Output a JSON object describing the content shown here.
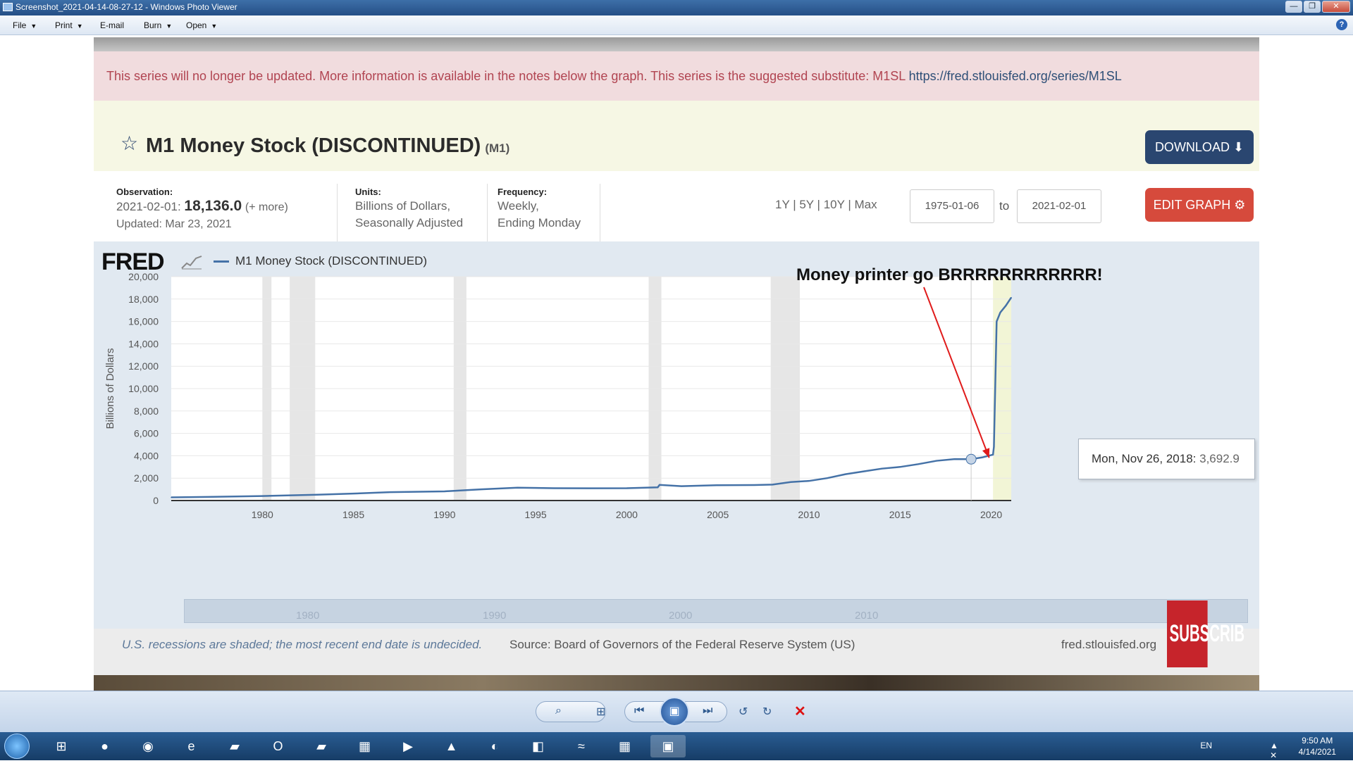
{
  "window": {
    "title": "Screenshot_2021-04-14-08-27-12 - Windows Photo Viewer",
    "buttons": {
      "minimize": "—",
      "maximize": "❐",
      "close": "✕"
    }
  },
  "menu": {
    "items": [
      "File",
      "Print",
      "E-mail",
      "Burn",
      "Open"
    ],
    "help": "?"
  },
  "fred": {
    "warning_text": "This series will no longer be updated. More information is available in the notes below the graph. This series is the suggested substitute: M1SL ",
    "warning_link": "https://fred.stlouisfed.org/series/M1SL",
    "title": "M1 Money Stock (DISCONTINUED)",
    "series_id": "(M1)",
    "download_label": "DOWNLOAD",
    "observation": {
      "label": "Observation:",
      "date": "2021-02-01:",
      "value": "18,136.0",
      "more": "(+ more)",
      "updated": "Updated: Mar 23, 2021"
    },
    "units": {
      "label": "Units:",
      "line1": "Billions of Dollars,",
      "line2": "Seasonally Adjusted"
    },
    "frequency": {
      "label": "Frequency:",
      "line1": "Weekly,",
      "line2": "Ending Monday"
    },
    "ranges": "1Y | 5Y | 10Y | Max",
    "date_from": "1975-01-06",
    "to_label": "to",
    "date_to": "2021-02-01",
    "edit_label": "EDIT GRAPH",
    "logo": "FRED",
    "legend": "M1 Money Stock (DISCONTINUED)",
    "annotation": "Money printer go BRRRRRRRRRRRR!",
    "tooltip_date": "Mon, Nov 26, 2018:",
    "tooltip_value": "3,692.9",
    "navigator_labels": [
      "1980",
      "1990",
      "2000",
      "2010"
    ],
    "footer_note": "U.S. recessions are shaded; the most recent end date is undecided.",
    "footer_source": "Source: Board of Governors of the Federal Reserve System (US)",
    "footer_site": "fred.stlouisfed.org",
    "overlay_sticker": "SUBSCRIB"
  },
  "chart_data": {
    "type": "line",
    "ylabel": "Billions of Dollars",
    "ylim": [
      0,
      20000
    ],
    "xlim": [
      1975,
      2021.1
    ],
    "yticks": [
      0,
      2000,
      4000,
      6000,
      8000,
      10000,
      12000,
      14000,
      16000,
      18000,
      20000
    ],
    "ytick_labels": [
      "0",
      "2,000",
      "4,000",
      "6,000",
      "8,000",
      "10,000",
      "12,000",
      "14,000",
      "16,000",
      "18,000",
      "20,000"
    ],
    "xticks": [
      1980,
      1985,
      1990,
      1995,
      2000,
      2005,
      2010,
      2015,
      2020
    ],
    "xtick_labels": [
      "1980",
      "1985",
      "1990",
      "1995",
      "2000",
      "2005",
      "2010",
      "2015",
      "2020"
    ],
    "recessions": [
      [
        1980.0,
        1980.5
      ],
      [
        1981.5,
        1982.9
      ],
      [
        1990.5,
        1991.2
      ],
      [
        2001.2,
        2001.9
      ],
      [
        2007.9,
        2009.5
      ],
      [
        2020.1,
        2021.1
      ]
    ],
    "series": [
      {
        "name": "M1 Money Stock (DISCONTINUED)",
        "color": "#4572a7",
        "x": [
          1975,
          1977,
          1980,
          1983,
          1985,
          1987,
          1990,
          1992,
          1994,
          1996,
          1998,
          2000,
          2001.7,
          2001.8,
          2003,
          2005,
          2007,
          2008,
          2009,
          2010,
          2011,
          2012,
          2013,
          2014,
          2015,
          2016,
          2017,
          2018,
          2018.9,
          2019.5,
          2020.1,
          2020.15,
          2020.3,
          2020.5,
          2020.8,
          2021.1
        ],
        "y": [
          280,
          320,
          400,
          520,
          620,
          750,
          820,
          1000,
          1150,
          1100,
          1090,
          1100,
          1180,
          1400,
          1280,
          1370,
          1380,
          1420,
          1650,
          1750,
          2000,
          2350,
          2600,
          2850,
          3000,
          3250,
          3550,
          3700,
          3693,
          3850,
          4100,
          4800,
          16000,
          16800,
          17400,
          18136
        ]
      }
    ]
  },
  "toolbar": {
    "zoom": "⌕",
    "fit": "⊞",
    "prev": "⏮",
    "slideshow": "▣",
    "next": "⏭",
    "rotate_ccw": "↺",
    "rotate_cw": "↻",
    "delete": "✕"
  },
  "taskbar": {
    "apps": [
      "⊞",
      "●",
      "◉",
      "e",
      "▰",
      "O",
      "▰",
      "▦",
      "▶",
      "▲",
      "◐",
      "◧",
      "≈",
      "▦",
      "▣"
    ],
    "lang": "EN",
    "tray_icons": "▲ ✕ ▮ ◀",
    "time": "9:50 AM",
    "date": "4/14/2021"
  }
}
